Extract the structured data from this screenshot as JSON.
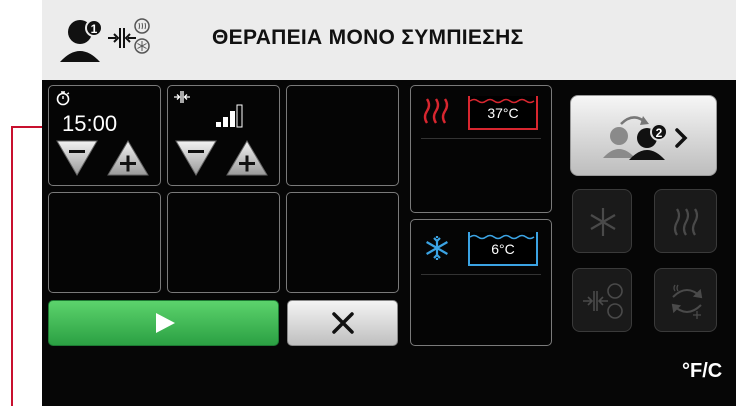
{
  "header": {
    "title": "ΘΕΡΑΠΕΙΑ ΜΟΝΟ ΣΥΜΠΙΕΣΗΣ",
    "mode_badge": "1"
  },
  "timer": {
    "value": "15:00",
    "icon": "timer-icon"
  },
  "compression": {
    "icon": "compression-icon",
    "level_bars_filled": 3,
    "level_bars_total": 4
  },
  "heat": {
    "icon": "heat-waves-icon",
    "temperature": "37°C",
    "color": "#d8262f"
  },
  "cold": {
    "icon": "snowflake-icon",
    "temperature": "6°C",
    "color": "#3ba3e3"
  },
  "controls": {
    "start_icon": "play-icon",
    "cancel_icon": "close-icon",
    "start_color": "#38b24c"
  },
  "side": {
    "switch_patient_badge": "2",
    "buttons": [
      "cold-mode-icon",
      "heat-mode-icon",
      "compression-mode-icon",
      "contrast-cycle-icon"
    ]
  },
  "units": {
    "label": "°F/C"
  }
}
